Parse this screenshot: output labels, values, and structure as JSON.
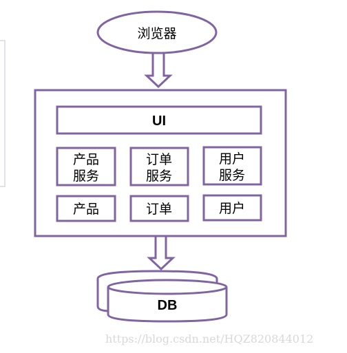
{
  "browser": "浏览器",
  "ui": "UI",
  "services": [
    "产品\n服务",
    "订单\n服务",
    "用户\n服务"
  ],
  "service_lines": [
    [
      "产品",
      "服务"
    ],
    [
      "订单",
      "服务"
    ],
    [
      "用户",
      "服务"
    ]
  ],
  "modules": [
    "产品",
    "订单",
    "用户"
  ],
  "db": "DB",
  "watermark": "https://blog.csdn.net/HQZ820844012",
  "colors": {
    "stroke": "#8064a2",
    "watermark": "#d8d8d8"
  }
}
